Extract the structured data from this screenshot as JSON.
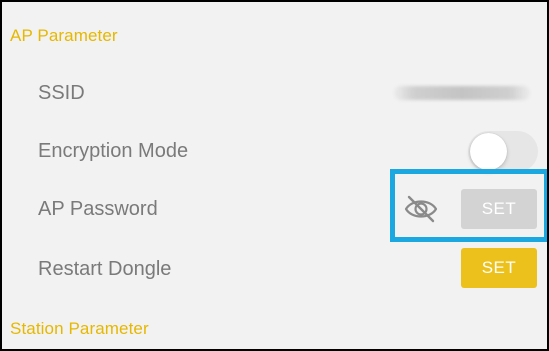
{
  "colors": {
    "accent": "#e6b800",
    "set_active": "#edc11c",
    "set_disabled": "#d3d3d3",
    "highlight": "#1ba7e0",
    "label": "#7a7a7a",
    "background": "#f2f2f2"
  },
  "ap_section": {
    "header": "AP Parameter",
    "rows": [
      {
        "label": "SSID",
        "value": ""
      },
      {
        "label": "Encryption Mode",
        "toggle": "off"
      },
      {
        "label": "AP Password",
        "icon": "eye-slash-icon",
        "button_label": "SET",
        "button_state": "disabled"
      },
      {
        "label": "Restart Dongle",
        "button_label": "SET",
        "button_state": "enabled"
      }
    ]
  },
  "station_section": {
    "header": "Station Parameter"
  }
}
